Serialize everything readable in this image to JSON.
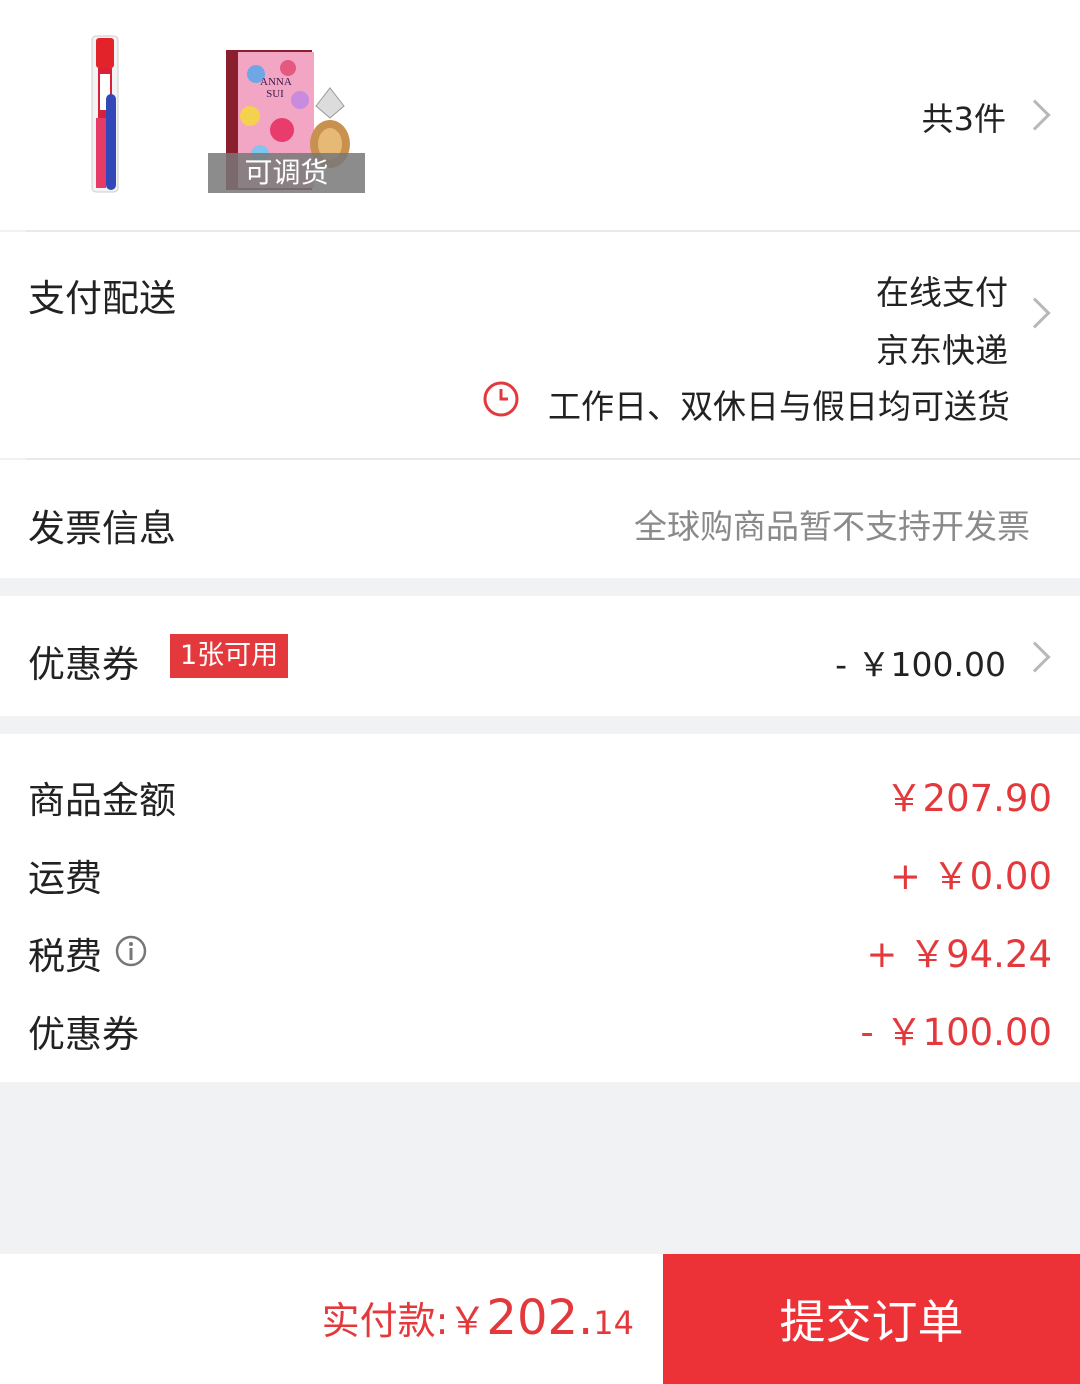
{
  "products": {
    "items": [
      {
        "name": "toothbrush",
        "overlay": ""
      },
      {
        "name": "anna-sui-perfume",
        "brand_text": "ANNA SUI",
        "overlay": "可调货"
      }
    ],
    "count_text": "共3件"
  },
  "payment": {
    "label": "支付配送",
    "method": "在线支付",
    "courier": "京东快递",
    "delivery_note": "工作日、双休日与假日均可送货"
  },
  "invoice": {
    "label": "发票信息",
    "value": "全球购商品暂不支持开发票"
  },
  "coupon": {
    "label": "优惠券",
    "badge": "1张可用",
    "value": "- ￥100.00"
  },
  "summary": {
    "rows": [
      {
        "label": "商品金额",
        "value": "￥207.90"
      },
      {
        "label": "运费",
        "value": "+ ￥0.00"
      },
      {
        "label": "税费",
        "value": "+ ￥94.24"
      },
      {
        "label": "优惠券",
        "value": "- ￥100.00"
      }
    ]
  },
  "footer": {
    "total_label": "实付款:",
    "currency": "￥",
    "total_int": "202.",
    "total_dec": "14",
    "submit_label": "提交订单"
  },
  "colors": {
    "accent": "#e4393c",
    "submit_bg": "#ec3137",
    "background": "#f1f2f4"
  }
}
